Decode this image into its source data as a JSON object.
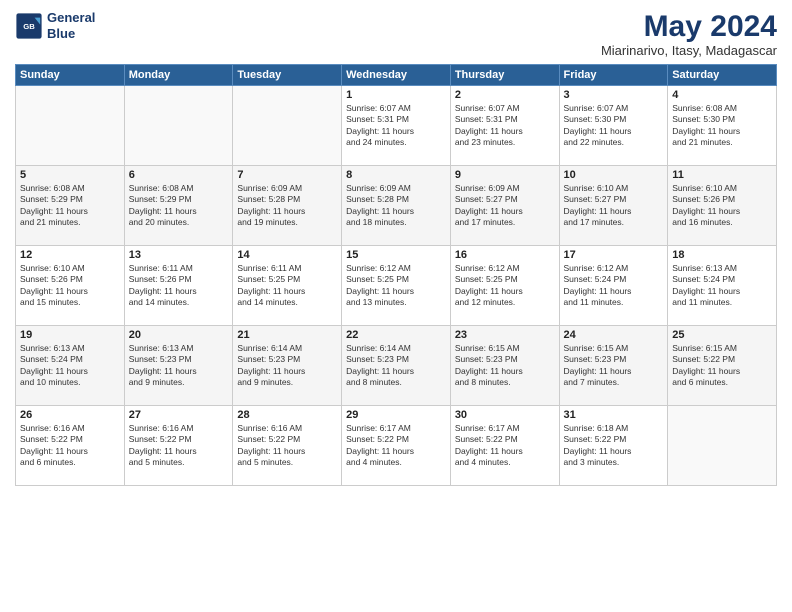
{
  "logo": {
    "line1": "General",
    "line2": "Blue"
  },
  "title": "May 2024",
  "subtitle": "Miarinarivo, Itasy, Madagascar",
  "days_header": [
    "Sunday",
    "Monday",
    "Tuesday",
    "Wednesday",
    "Thursday",
    "Friday",
    "Saturday"
  ],
  "weeks": [
    [
      {
        "day": "",
        "info": ""
      },
      {
        "day": "",
        "info": ""
      },
      {
        "day": "",
        "info": ""
      },
      {
        "day": "1",
        "info": "Sunrise: 6:07 AM\nSunset: 5:31 PM\nDaylight: 11 hours\nand 24 minutes."
      },
      {
        "day": "2",
        "info": "Sunrise: 6:07 AM\nSunset: 5:31 PM\nDaylight: 11 hours\nand 23 minutes."
      },
      {
        "day": "3",
        "info": "Sunrise: 6:07 AM\nSunset: 5:30 PM\nDaylight: 11 hours\nand 22 minutes."
      },
      {
        "day": "4",
        "info": "Sunrise: 6:08 AM\nSunset: 5:30 PM\nDaylight: 11 hours\nand 21 minutes."
      }
    ],
    [
      {
        "day": "5",
        "info": "Sunrise: 6:08 AM\nSunset: 5:29 PM\nDaylight: 11 hours\nand 21 minutes."
      },
      {
        "day": "6",
        "info": "Sunrise: 6:08 AM\nSunset: 5:29 PM\nDaylight: 11 hours\nand 20 minutes."
      },
      {
        "day": "7",
        "info": "Sunrise: 6:09 AM\nSunset: 5:28 PM\nDaylight: 11 hours\nand 19 minutes."
      },
      {
        "day": "8",
        "info": "Sunrise: 6:09 AM\nSunset: 5:28 PM\nDaylight: 11 hours\nand 18 minutes."
      },
      {
        "day": "9",
        "info": "Sunrise: 6:09 AM\nSunset: 5:27 PM\nDaylight: 11 hours\nand 17 minutes."
      },
      {
        "day": "10",
        "info": "Sunrise: 6:10 AM\nSunset: 5:27 PM\nDaylight: 11 hours\nand 17 minutes."
      },
      {
        "day": "11",
        "info": "Sunrise: 6:10 AM\nSunset: 5:26 PM\nDaylight: 11 hours\nand 16 minutes."
      }
    ],
    [
      {
        "day": "12",
        "info": "Sunrise: 6:10 AM\nSunset: 5:26 PM\nDaylight: 11 hours\nand 15 minutes."
      },
      {
        "day": "13",
        "info": "Sunrise: 6:11 AM\nSunset: 5:26 PM\nDaylight: 11 hours\nand 14 minutes."
      },
      {
        "day": "14",
        "info": "Sunrise: 6:11 AM\nSunset: 5:25 PM\nDaylight: 11 hours\nand 14 minutes."
      },
      {
        "day": "15",
        "info": "Sunrise: 6:12 AM\nSunset: 5:25 PM\nDaylight: 11 hours\nand 13 minutes."
      },
      {
        "day": "16",
        "info": "Sunrise: 6:12 AM\nSunset: 5:25 PM\nDaylight: 11 hours\nand 12 minutes."
      },
      {
        "day": "17",
        "info": "Sunrise: 6:12 AM\nSunset: 5:24 PM\nDaylight: 11 hours\nand 11 minutes."
      },
      {
        "day": "18",
        "info": "Sunrise: 6:13 AM\nSunset: 5:24 PM\nDaylight: 11 hours\nand 11 minutes."
      }
    ],
    [
      {
        "day": "19",
        "info": "Sunrise: 6:13 AM\nSunset: 5:24 PM\nDaylight: 11 hours\nand 10 minutes."
      },
      {
        "day": "20",
        "info": "Sunrise: 6:13 AM\nSunset: 5:23 PM\nDaylight: 11 hours\nand 9 minutes."
      },
      {
        "day": "21",
        "info": "Sunrise: 6:14 AM\nSunset: 5:23 PM\nDaylight: 11 hours\nand 9 minutes."
      },
      {
        "day": "22",
        "info": "Sunrise: 6:14 AM\nSunset: 5:23 PM\nDaylight: 11 hours\nand 8 minutes."
      },
      {
        "day": "23",
        "info": "Sunrise: 6:15 AM\nSunset: 5:23 PM\nDaylight: 11 hours\nand 8 minutes."
      },
      {
        "day": "24",
        "info": "Sunrise: 6:15 AM\nSunset: 5:23 PM\nDaylight: 11 hours\nand 7 minutes."
      },
      {
        "day": "25",
        "info": "Sunrise: 6:15 AM\nSunset: 5:22 PM\nDaylight: 11 hours\nand 6 minutes."
      }
    ],
    [
      {
        "day": "26",
        "info": "Sunrise: 6:16 AM\nSunset: 5:22 PM\nDaylight: 11 hours\nand 6 minutes."
      },
      {
        "day": "27",
        "info": "Sunrise: 6:16 AM\nSunset: 5:22 PM\nDaylight: 11 hours\nand 5 minutes."
      },
      {
        "day": "28",
        "info": "Sunrise: 6:16 AM\nSunset: 5:22 PM\nDaylight: 11 hours\nand 5 minutes."
      },
      {
        "day": "29",
        "info": "Sunrise: 6:17 AM\nSunset: 5:22 PM\nDaylight: 11 hours\nand 4 minutes."
      },
      {
        "day": "30",
        "info": "Sunrise: 6:17 AM\nSunset: 5:22 PM\nDaylight: 11 hours\nand 4 minutes."
      },
      {
        "day": "31",
        "info": "Sunrise: 6:18 AM\nSunset: 5:22 PM\nDaylight: 11 hours\nand 3 minutes."
      },
      {
        "day": "",
        "info": ""
      }
    ]
  ]
}
